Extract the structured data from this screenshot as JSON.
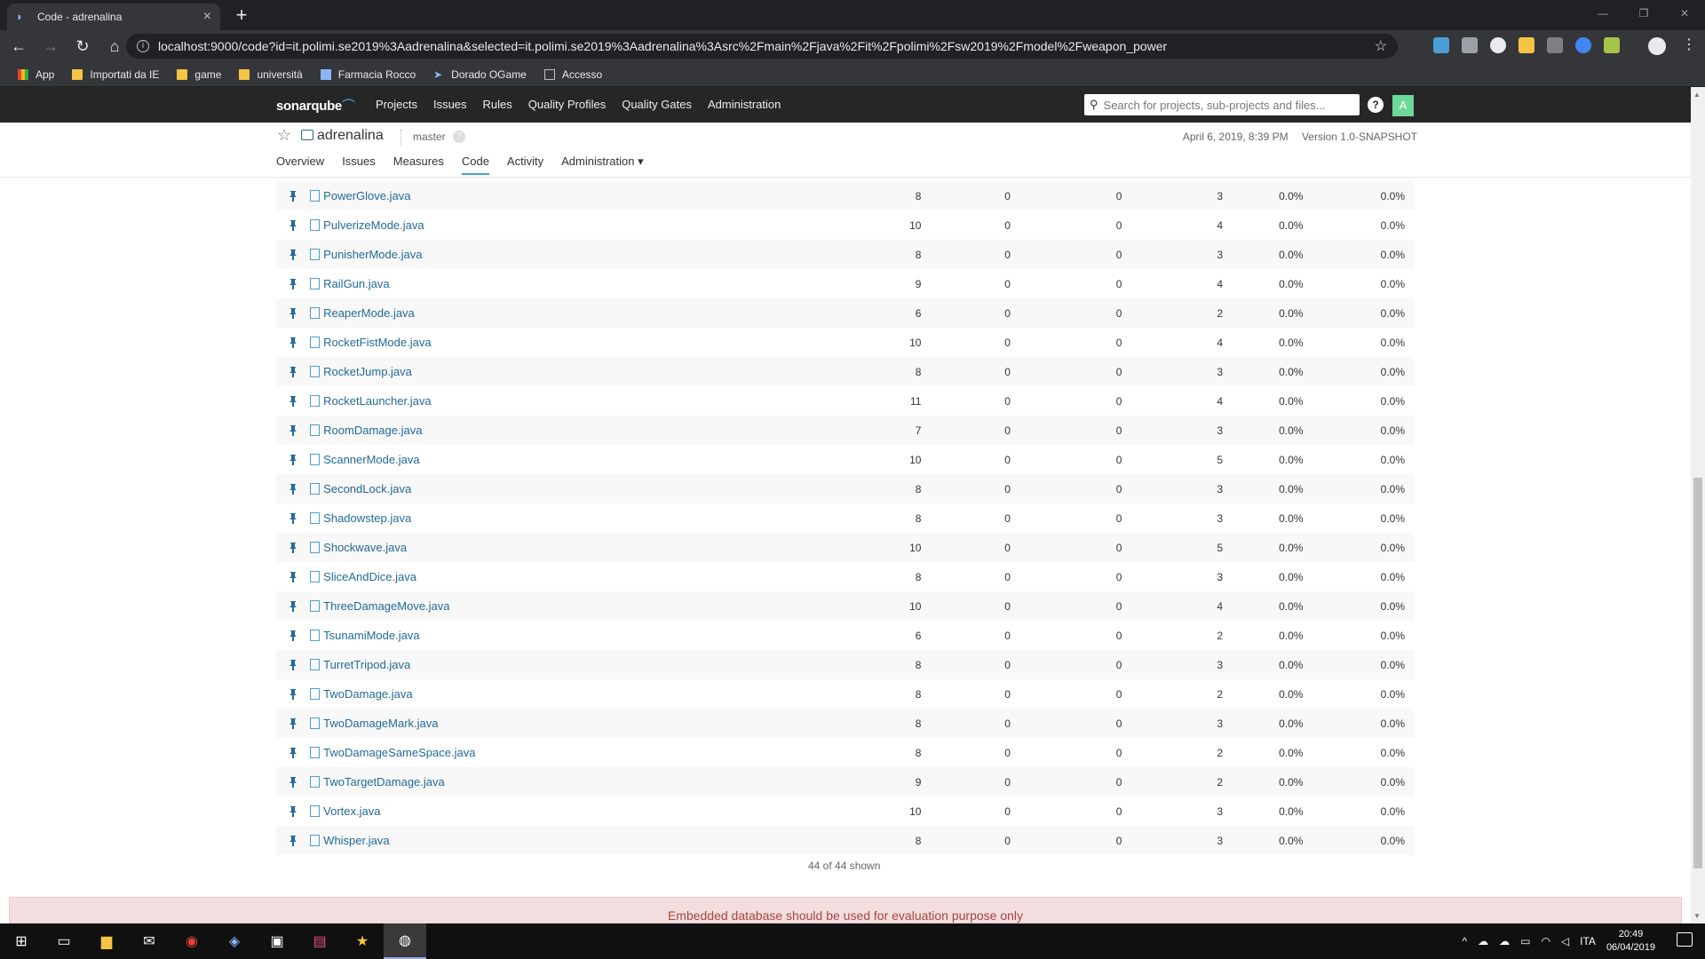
{
  "browser": {
    "tab_title": "Code - adrenalina",
    "url": "localhost:9000/code?id=it.polimi.se2019%3Aadrenalina&selected=it.polimi.se2019%3Aadrenalina%3Asrc%2Fmain%2Fjava%2Fit%2Fpolimi%2Fsw2019%2Fmodel%2Fweapon_power",
    "bookmarks": [
      "App",
      "Importati da IE",
      "game",
      "università",
      "Farmacia Rocco",
      "Dorado OGame",
      "Accesso"
    ]
  },
  "sq_nav": {
    "logo": "sonarqube",
    "menu": [
      "Projects",
      "Issues",
      "Rules",
      "Quality Profiles",
      "Quality Gates",
      "Administration"
    ],
    "search_placeholder": "Search for projects, sub-projects and files...",
    "help": "?",
    "avatar": "A"
  },
  "project": {
    "name": "adrenalina",
    "branch": "master",
    "date": "April 6, 2019, 8:39 PM",
    "version": "Version 1.0-SNAPSHOT",
    "tabs": [
      "Overview",
      "Issues",
      "Measures",
      "Code",
      "Activity",
      "Administration ▾"
    ],
    "active_tab": "Code"
  },
  "files": [
    {
      "name": "PowerGlove.java",
      "v1": "8",
      "v2": "0",
      "v3": "0",
      "v4": "3",
      "v5": "0.0%",
      "v6": "0.0%"
    },
    {
      "name": "PulverizeMode.java",
      "v1": "10",
      "v2": "0",
      "v3": "0",
      "v4": "4",
      "v5": "0.0%",
      "v6": "0.0%"
    },
    {
      "name": "PunisherMode.java",
      "v1": "8",
      "v2": "0",
      "v3": "0",
      "v4": "3",
      "v5": "0.0%",
      "v6": "0.0%"
    },
    {
      "name": "RailGun.java",
      "v1": "9",
      "v2": "0",
      "v3": "0",
      "v4": "4",
      "v5": "0.0%",
      "v6": "0.0%"
    },
    {
      "name": "ReaperMode.java",
      "v1": "6",
      "v2": "0",
      "v3": "0",
      "v4": "2",
      "v5": "0.0%",
      "v6": "0.0%"
    },
    {
      "name": "RocketFistMode.java",
      "v1": "10",
      "v2": "0",
      "v3": "0",
      "v4": "4",
      "v5": "0.0%",
      "v6": "0.0%"
    },
    {
      "name": "RocketJump.java",
      "v1": "8",
      "v2": "0",
      "v3": "0",
      "v4": "3",
      "v5": "0.0%",
      "v6": "0.0%"
    },
    {
      "name": "RocketLauncher.java",
      "v1": "11",
      "v2": "0",
      "v3": "0",
      "v4": "4",
      "v5": "0.0%",
      "v6": "0.0%"
    },
    {
      "name": "RoomDamage.java",
      "v1": "7",
      "v2": "0",
      "v3": "0",
      "v4": "3",
      "v5": "0.0%",
      "v6": "0.0%"
    },
    {
      "name": "ScannerMode.java",
      "v1": "10",
      "v2": "0",
      "v3": "0",
      "v4": "5",
      "v5": "0.0%",
      "v6": "0.0%"
    },
    {
      "name": "SecondLock.java",
      "v1": "8",
      "v2": "0",
      "v3": "0",
      "v4": "3",
      "v5": "0.0%",
      "v6": "0.0%"
    },
    {
      "name": "Shadowstep.java",
      "v1": "8",
      "v2": "0",
      "v3": "0",
      "v4": "3",
      "v5": "0.0%",
      "v6": "0.0%"
    },
    {
      "name": "Shockwave.java",
      "v1": "10",
      "v2": "0",
      "v3": "0",
      "v4": "5",
      "v5": "0.0%",
      "v6": "0.0%"
    },
    {
      "name": "SliceAndDice.java",
      "v1": "8",
      "v2": "0",
      "v3": "0",
      "v4": "3",
      "v5": "0.0%",
      "v6": "0.0%"
    },
    {
      "name": "ThreeDamageMove.java",
      "v1": "10",
      "v2": "0",
      "v3": "0",
      "v4": "4",
      "v5": "0.0%",
      "v6": "0.0%"
    },
    {
      "name": "TsunamiMode.java",
      "v1": "6",
      "v2": "0",
      "v3": "0",
      "v4": "2",
      "v5": "0.0%",
      "v6": "0.0%"
    },
    {
      "name": "TurretTripod.java",
      "v1": "8",
      "v2": "0",
      "v3": "0",
      "v4": "3",
      "v5": "0.0%",
      "v6": "0.0%"
    },
    {
      "name": "TwoDamage.java",
      "v1": "8",
      "v2": "0",
      "v3": "0",
      "v4": "2",
      "v5": "0.0%",
      "v6": "0.0%"
    },
    {
      "name": "TwoDamageMark.java",
      "v1": "8",
      "v2": "0",
      "v3": "0",
      "v4": "3",
      "v5": "0.0%",
      "v6": "0.0%"
    },
    {
      "name": "TwoDamageSameSpace.java",
      "v1": "8",
      "v2": "0",
      "v3": "0",
      "v4": "2",
      "v5": "0.0%",
      "v6": "0.0%"
    },
    {
      "name": "TwoTargetDamage.java",
      "v1": "9",
      "v2": "0",
      "v3": "0",
      "v4": "2",
      "v5": "0.0%",
      "v6": "0.0%"
    },
    {
      "name": "Vortex.java",
      "v1": "10",
      "v2": "0",
      "v3": "0",
      "v4": "3",
      "v5": "0.0%",
      "v6": "0.0%"
    },
    {
      "name": "Whisper.java",
      "v1": "8",
      "v2": "0",
      "v3": "0",
      "v4": "3",
      "v5": "0.0%",
      "v6": "0.0%"
    }
  ],
  "shown_count": "44 of 44 shown",
  "db_warning": "Embedded database should be used for evaluation purpose only",
  "taskbar": {
    "lang": "ITA",
    "time": "20:49",
    "date": "06/04/2019"
  }
}
